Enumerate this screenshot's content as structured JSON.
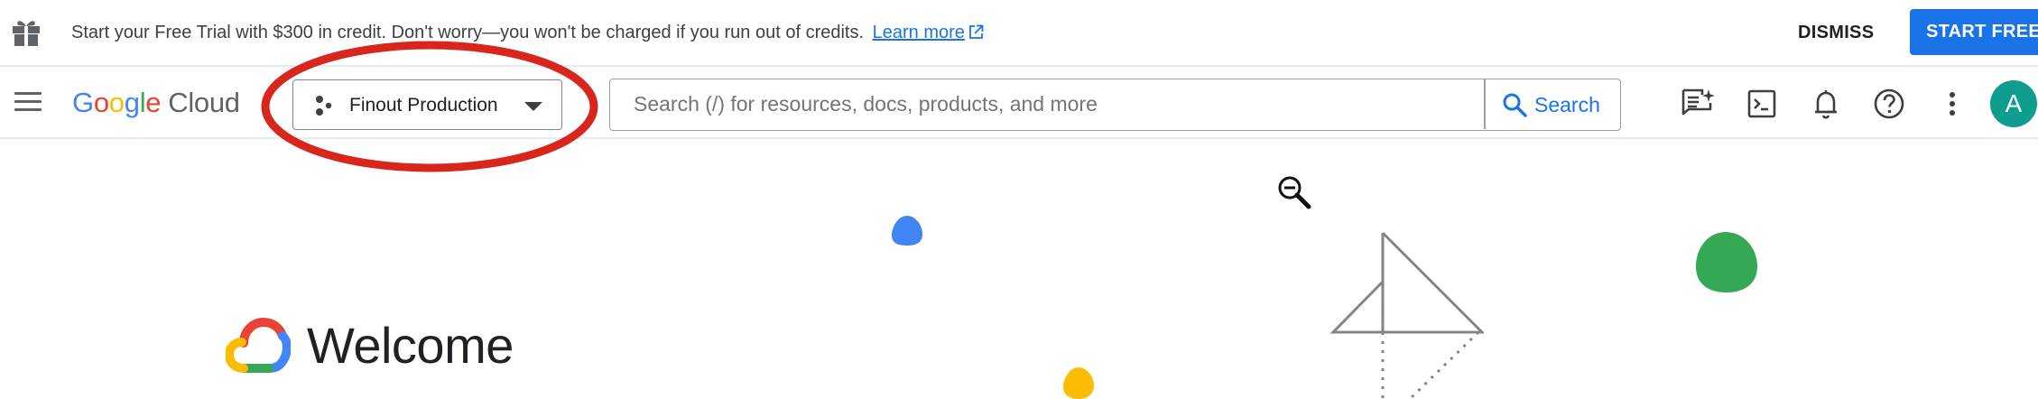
{
  "banner": {
    "message": "Start your Free Trial with $300 in credit. Don't worry—you won't be charged if you run out of credits.",
    "learn_more_label": "Learn more",
    "dismiss_label": "DISMISS",
    "start_free_label": "START FREE"
  },
  "header": {
    "logo_google": [
      "G",
      "o",
      "o",
      "g",
      "l",
      "e"
    ],
    "logo_cloud": "Cloud",
    "project_name": "Finout Production",
    "search": {
      "placeholder": "Search (/) for resources, docs, products, and more",
      "value": "",
      "button_label": "Search"
    },
    "icons": [
      "gemini-chat-icon",
      "cloud-shell-icon",
      "notifications-bell-icon",
      "help-icon",
      "more-vert-icon"
    ],
    "avatar_initial": "A"
  },
  "welcome": {
    "title": "Welcome"
  },
  "colors": {
    "accent": "#1a73e8",
    "highlight_circle": "#d9261c",
    "avatar_bg": "#0f9d8f",
    "deco_blue": "#4285f4",
    "deco_yellow": "#fbbc04",
    "deco_green": "#34a853"
  }
}
